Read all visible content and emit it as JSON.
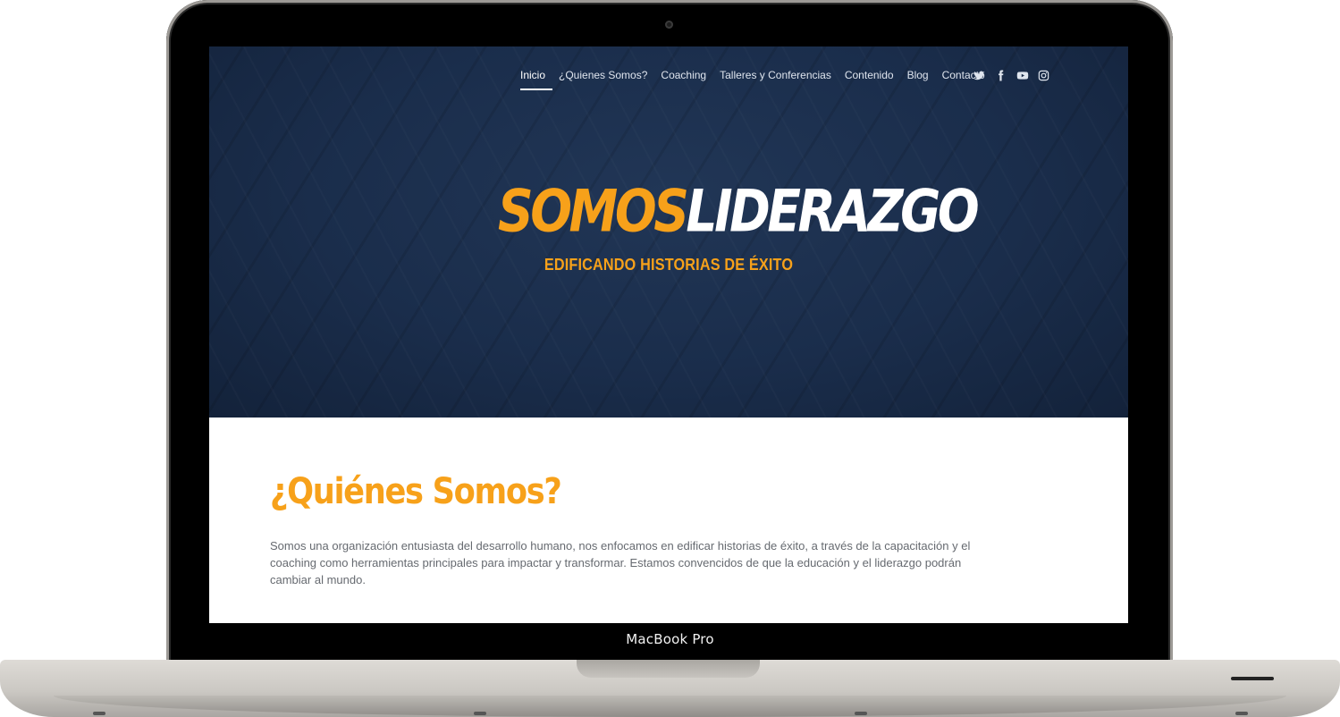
{
  "device": {
    "label": "MacBook Pro"
  },
  "nav": {
    "items": [
      {
        "label": "Inicio",
        "active": true
      },
      {
        "label": "¿Quienes Somos?"
      },
      {
        "label": "Coaching"
      },
      {
        "label": "Talleres y Conferencias"
      },
      {
        "label": "Contenido"
      },
      {
        "label": "Blog"
      },
      {
        "label": "Contacto"
      }
    ]
  },
  "social": {
    "icons": [
      "twitter-icon",
      "facebook-icon",
      "youtube-icon",
      "instagram-icon"
    ]
  },
  "hero": {
    "logo_part1": "SOMOS",
    "logo_part2": "LIDERAZGO",
    "tagline": "EDIFICANDO HISTORIAS DE ÉXITO"
  },
  "about": {
    "title": "¿Quiénes Somos?",
    "text": "Somos una organización entusiasta del desarrollo humano, nos enfocamos en edificar historias de éxito, a través de la capacitación y el coaching como herramientas principales para impactar y transformar. Estamos convencidos de que la educación y el liderazgo podrán cambiar al mundo."
  },
  "colors": {
    "accent": "#f7a11a",
    "hero_bg": "#1a2d4b",
    "body_text": "#666a70"
  }
}
